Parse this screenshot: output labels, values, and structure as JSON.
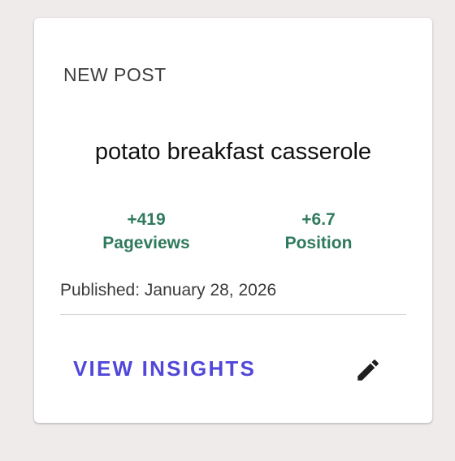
{
  "card": {
    "eyebrow": "NEW POST",
    "title": "potato breakfast casserole",
    "stats": [
      {
        "value": "+419",
        "label": "Pageviews"
      },
      {
        "value": "+6.7",
        "label": "Position"
      }
    ],
    "published": "Published: January 28, 2026",
    "actions": {
      "insights_label": "VIEW INSIGHTS",
      "edit_icon": "pencil-icon"
    }
  },
  "colors": {
    "background": "#efebea",
    "card": "#ffffff",
    "stat_green": "#2f7a5c",
    "accent": "#5147d8"
  }
}
